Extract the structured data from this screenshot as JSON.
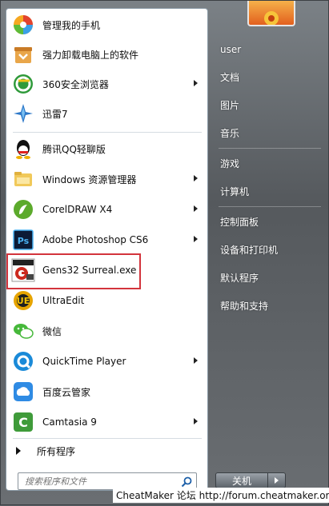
{
  "left_menu": {
    "items": [
      {
        "label": "管理我的手机",
        "icon": "phone-manager-icon",
        "submenu": false
      },
      {
        "label": "强力卸载电脑上的软件",
        "icon": "uninstaller-icon",
        "submenu": false
      },
      {
        "label": "360安全浏览器",
        "icon": "browser-360-icon",
        "submenu": true
      },
      {
        "label": "迅雷7",
        "icon": "xunlei-icon",
        "submenu": false
      },
      {
        "label": "腾讯QQ轻聊版",
        "icon": "qq-icon",
        "submenu": false
      },
      {
        "label": "Windows 资源管理器",
        "icon": "explorer-folder-icon",
        "submenu": true
      },
      {
        "label": "CorelDRAW X4",
        "icon": "coreldraw-icon",
        "submenu": true
      },
      {
        "label": "Adobe Photoshop CS6",
        "icon": "photoshop-icon",
        "submenu": true
      },
      {
        "label": "Gens32 Surreal.exe",
        "icon": "gens32-icon",
        "submenu": false,
        "highlighted": true
      },
      {
        "label": "UltraEdit",
        "icon": "ultraedit-icon",
        "submenu": false
      },
      {
        "label": "微信",
        "icon": "wechat-icon",
        "submenu": false
      },
      {
        "label": "QuickTime Player",
        "icon": "quicktime-icon",
        "submenu": true
      },
      {
        "label": "百度云管家",
        "icon": "baidu-cloud-icon",
        "submenu": false
      },
      {
        "label": "Camtasia 9",
        "icon": "camtasia-icon",
        "submenu": true
      }
    ],
    "all_programs": "所有程序",
    "search_placeholder": "搜索程序和文件"
  },
  "right_menu": {
    "items": [
      "user",
      "文档",
      "图片",
      "音乐",
      "游戏",
      "计算机",
      "控制面板",
      "设备和打印机",
      "默认程序",
      "帮助和支持"
    ]
  },
  "shutdown_label": "关机",
  "watermark": "CheatMaker 论坛 http://forum.cheatmaker.org/",
  "colors": {
    "highlight_border": "#d3343c",
    "left_bg": "#ffffff"
  }
}
